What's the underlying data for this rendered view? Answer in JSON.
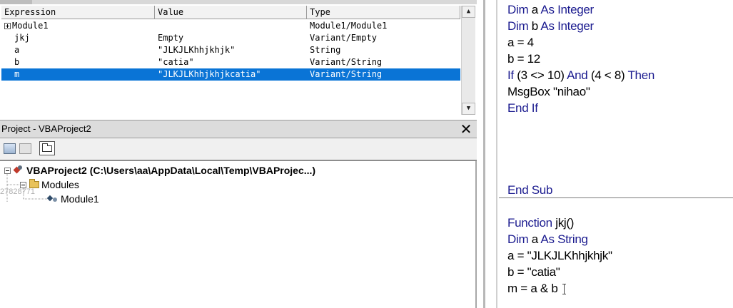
{
  "watch": {
    "headers": [
      "Expression",
      "Value",
      "Type"
    ],
    "rows": [
      {
        "expression": "Module1",
        "value": "",
        "type": "Module1/Module1"
      },
      {
        "expression": "jkj",
        "value": "Empty",
        "type": "Variant/Empty"
      },
      {
        "expression": "a",
        "value": "\"JLKJLKhhjkhjk\"",
        "type": "String"
      },
      {
        "expression": "b",
        "value": "\"catia\"",
        "type": "Variant/String"
      },
      {
        "expression": "m",
        "value": "\"JLKJLKhhjkhjkcatia\"",
        "type": "Variant/String"
      }
    ],
    "selected_row": 4
  },
  "project": {
    "title": "Project - VBAProject2",
    "close_glyph": "✕",
    "tree": {
      "root": "VBAProject2 (C:\\Users\\aa\\AppData\\Local\\Temp\\VBAProjec...)",
      "folder": "Modules",
      "module": "Module1"
    },
    "ghost_text": "27828771"
  },
  "code": {
    "line1": {
      "kw1": "Dim",
      "t1": " a ",
      "kw2": "As Integer"
    },
    "line2": {
      "kw1": "Dim",
      "t1": " b ",
      "kw2": "As Integer"
    },
    "line3": "a = 4",
    "line4": "b = 12",
    "line5": {
      "kw1": "If",
      "t1": " (3 <> 10) ",
      "kw2": "And",
      "t2": " (4 < 8) ",
      "kw3": "Then"
    },
    "line6": "MsgBox \"nihao\"",
    "line7": "End If",
    "line8": "End Sub",
    "line9": {
      "kw1": "Function",
      "t1": " jkj()"
    },
    "line10": {
      "kw1": "Dim",
      "t1": " a ",
      "kw2": "As String"
    },
    "line11": "a = \"JLKJLKhhjkhjk\"",
    "line12": "b = \"catia\"",
    "line13": "m = a & b"
  },
  "colors": {
    "selection": "#0a74d6",
    "keyword": "#1b1b8f"
  }
}
